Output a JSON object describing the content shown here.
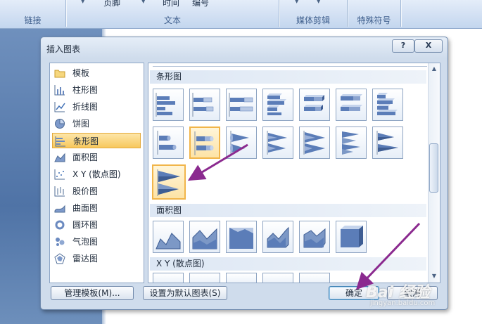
{
  "ribbon": {
    "items": [
      "页脚",
      "时间",
      "编号"
    ],
    "groups": [
      "链接",
      "文本",
      "媒体剪辑",
      "特殊符号"
    ]
  },
  "dialog": {
    "title": "插入图表",
    "help_glyph": "?",
    "close_glyph": "X",
    "chart_types": [
      {
        "label": "模板",
        "icon": "folder-icon"
      },
      {
        "label": "柱形图",
        "icon": "column-chart-icon"
      },
      {
        "label": "折线图",
        "icon": "line-chart-icon"
      },
      {
        "label": "饼图",
        "icon": "pie-chart-icon"
      },
      {
        "label": "条形图",
        "icon": "bar-chart-icon",
        "selected": true
      },
      {
        "label": "面积图",
        "icon": "area-chart-icon"
      },
      {
        "label": "X Y (散点图)",
        "icon": "scatter-chart-icon"
      },
      {
        "label": "股价图",
        "icon": "stock-chart-icon"
      },
      {
        "label": "曲面图",
        "icon": "surface-chart-icon"
      },
      {
        "label": "圆环图",
        "icon": "doughnut-chart-icon"
      },
      {
        "label": "气泡图",
        "icon": "bubble-chart-icon"
      },
      {
        "label": "雷达图",
        "icon": "radar-chart-icon"
      }
    ],
    "sections": {
      "bar": "条形图",
      "area": "面积图",
      "scatter": "X Y (散点图)"
    },
    "buttons": {
      "manage_templates": "管理模板(M)...",
      "set_default": "设置为默认图表(S)",
      "ok": "确定",
      "cancel": "取消"
    }
  },
  "watermark": {
    "main": "Bai 经验",
    "sub": "jingyan.baidu.com"
  },
  "colors": {
    "accent": "#f1b54a",
    "chart_blue": "#7c98c6",
    "annotation_arrow": "#8b2a8f"
  }
}
